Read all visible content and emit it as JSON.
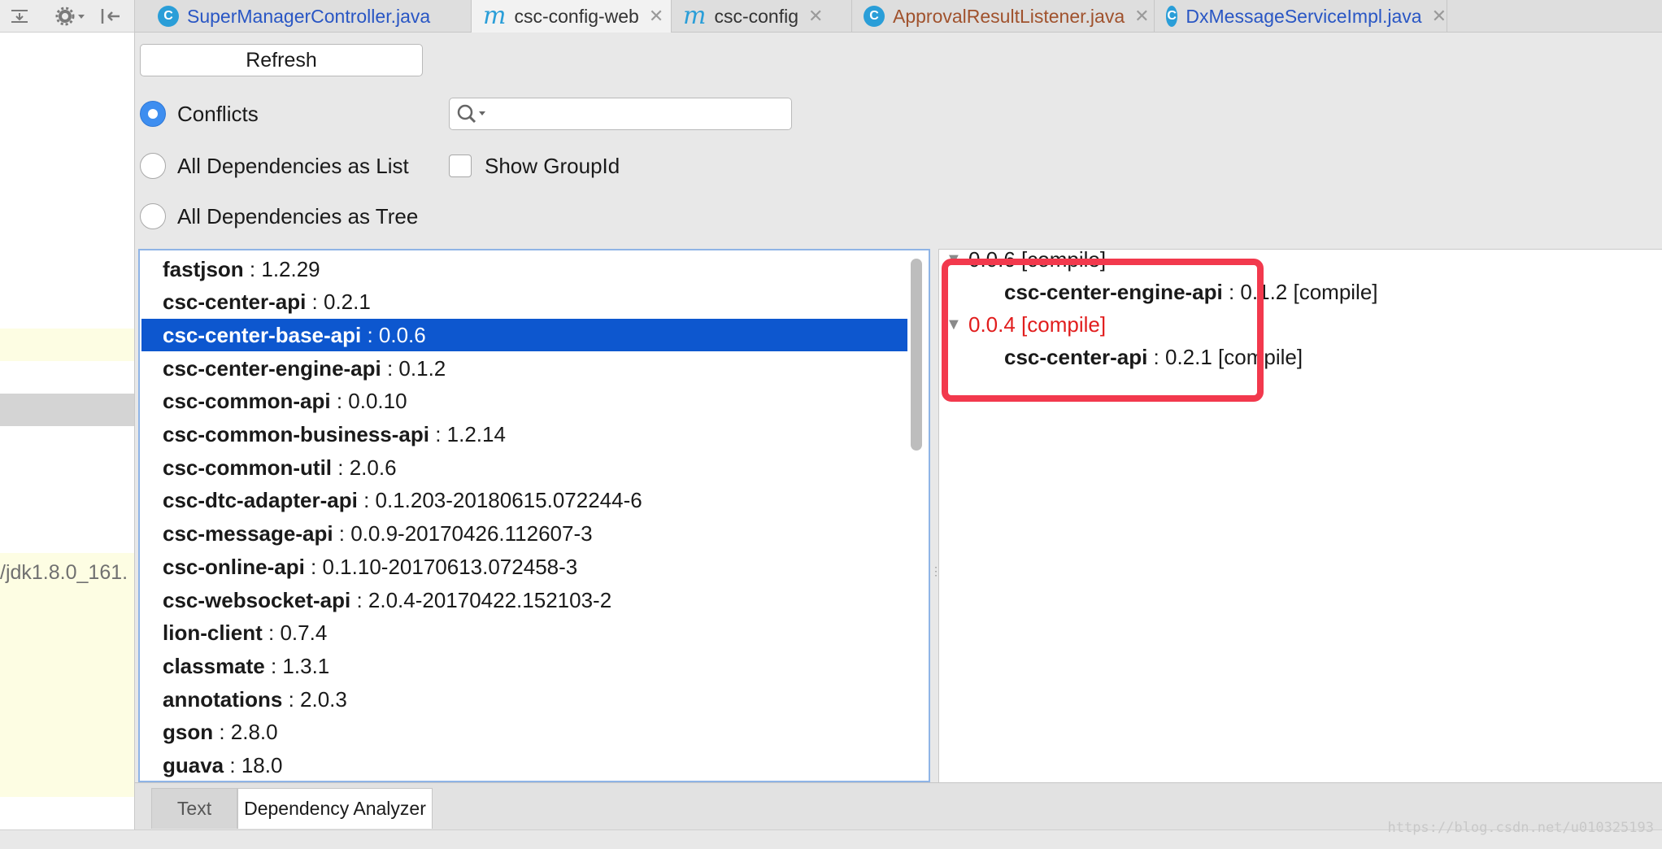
{
  "sidebar": {
    "jdk_text": "/jdk1.8.0_161."
  },
  "tabs": [
    {
      "label": "SuperManagerController.java",
      "icon": "class-icon",
      "color": "#2956c4"
    },
    {
      "label": "csc-config-web",
      "icon": "maven-icon",
      "color": "#333333"
    },
    {
      "label": "csc-config",
      "icon": "maven-icon",
      "color": "#333333"
    },
    {
      "label": "ApprovalResultListener.java",
      "icon": "class-icon",
      "color": "#a0522d"
    },
    {
      "label": "DxMessageServiceImpl.java",
      "icon": "class-icon",
      "color": "#2956c4"
    }
  ],
  "toolbar": {
    "refresh_label": "Refresh"
  },
  "view_options": {
    "conflicts": "Conflicts",
    "list": "All Dependencies as List",
    "tree": "All Dependencies as Tree",
    "selected": "Conflicts"
  },
  "search": {
    "value": ""
  },
  "show_group_id": {
    "label": "Show GroupId",
    "checked": false
  },
  "dependencies": [
    {
      "name": "fastjson",
      "version": " : 1.2.29"
    },
    {
      "name": "csc-center-api",
      "version": " : 0.2.1"
    },
    {
      "name": "csc-center-base-api",
      "version": " : 0.0.6"
    },
    {
      "name": "csc-center-engine-api",
      "version": " : 0.1.2"
    },
    {
      "name": "csc-common-api",
      "version": " : 0.0.10"
    },
    {
      "name": "csc-common-business-api",
      "version": " : 1.2.14"
    },
    {
      "name": "csc-common-util",
      "version": " : 2.0.6"
    },
    {
      "name": "csc-dtc-adapter-api",
      "version": " : 0.1.203-20180615.072244-6"
    },
    {
      "name": "csc-message-api",
      "version": " : 0.0.9-20170426.112607-3"
    },
    {
      "name": "csc-online-api",
      "version": " : 0.1.10-20170613.072458-3"
    },
    {
      "name": "csc-websocket-api",
      "version": " : 2.0.4-20170422.152103-2"
    },
    {
      "name": "lion-client",
      "version": " : 0.7.4"
    },
    {
      "name": "classmate",
      "version": " : 1.3.1"
    },
    {
      "name": "annotations",
      "version": " : 2.0.3"
    },
    {
      "name": "gson",
      "version": " : 2.8.0"
    },
    {
      "name": "guava",
      "version": " : 18.0"
    }
  ],
  "selected_dependency": "csc-center-base-api",
  "conflict_tree": [
    {
      "version": "0.0.6 [compile]",
      "conflict": false,
      "child_name": "csc-center-engine-api",
      "child_version": " : 0.1.2 [compile]"
    },
    {
      "version": "0.0.4 [compile]",
      "conflict": true,
      "child_name": "csc-center-api",
      "child_version": " : 0.2.1 [compile]"
    }
  ],
  "bottom_tabs": {
    "text": "Text",
    "analyzer": "Dependency Analyzer",
    "active": "Dependency Analyzer"
  },
  "watermark": "https://blog.csdn.net/u010325193",
  "colors": {
    "selection": "#0d57cf",
    "conflict": "#e11d1d",
    "highlight_box": "#f2394d"
  }
}
